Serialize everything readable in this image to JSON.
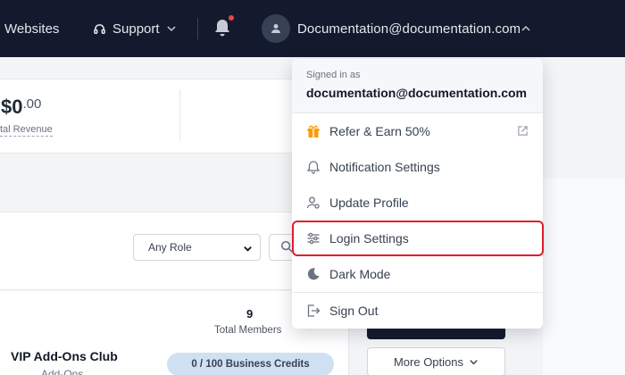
{
  "nav": {
    "websites": "Websites",
    "support": "Support",
    "user_email": "Documentation@documentation.com"
  },
  "stats": {
    "revenue_whole": "$0",
    "revenue_cents": ".00",
    "revenue_label": "tal Revenue"
  },
  "filters": {
    "role_selected": "Any Role"
  },
  "club": {
    "name": "VIP Add-Ons Club",
    "subtitle": "Add-Ons",
    "members_count": "9",
    "members_label": "Total Members",
    "credits": "0 / 100 Business Credits",
    "more_options": "More Options"
  },
  "menu": {
    "signed_in_as": "Signed in as",
    "email": "documentation@documentation.com",
    "items": [
      {
        "label": "Refer & Earn 50%",
        "icon": "gift-icon"
      },
      {
        "label": "Notification Settings",
        "icon": "bell-icon"
      },
      {
        "label": "Update Profile",
        "icon": "user-gear-icon"
      },
      {
        "label": "Login Settings",
        "icon": "sliders-icon"
      },
      {
        "label": "Dark Mode",
        "icon": "moon-icon"
      },
      {
        "label": "Sign Out",
        "icon": "sign-out-icon"
      }
    ]
  },
  "colors": {
    "navbar": "#141a2e",
    "highlight": "#e11d2a",
    "gift": "#f59e0b"
  }
}
